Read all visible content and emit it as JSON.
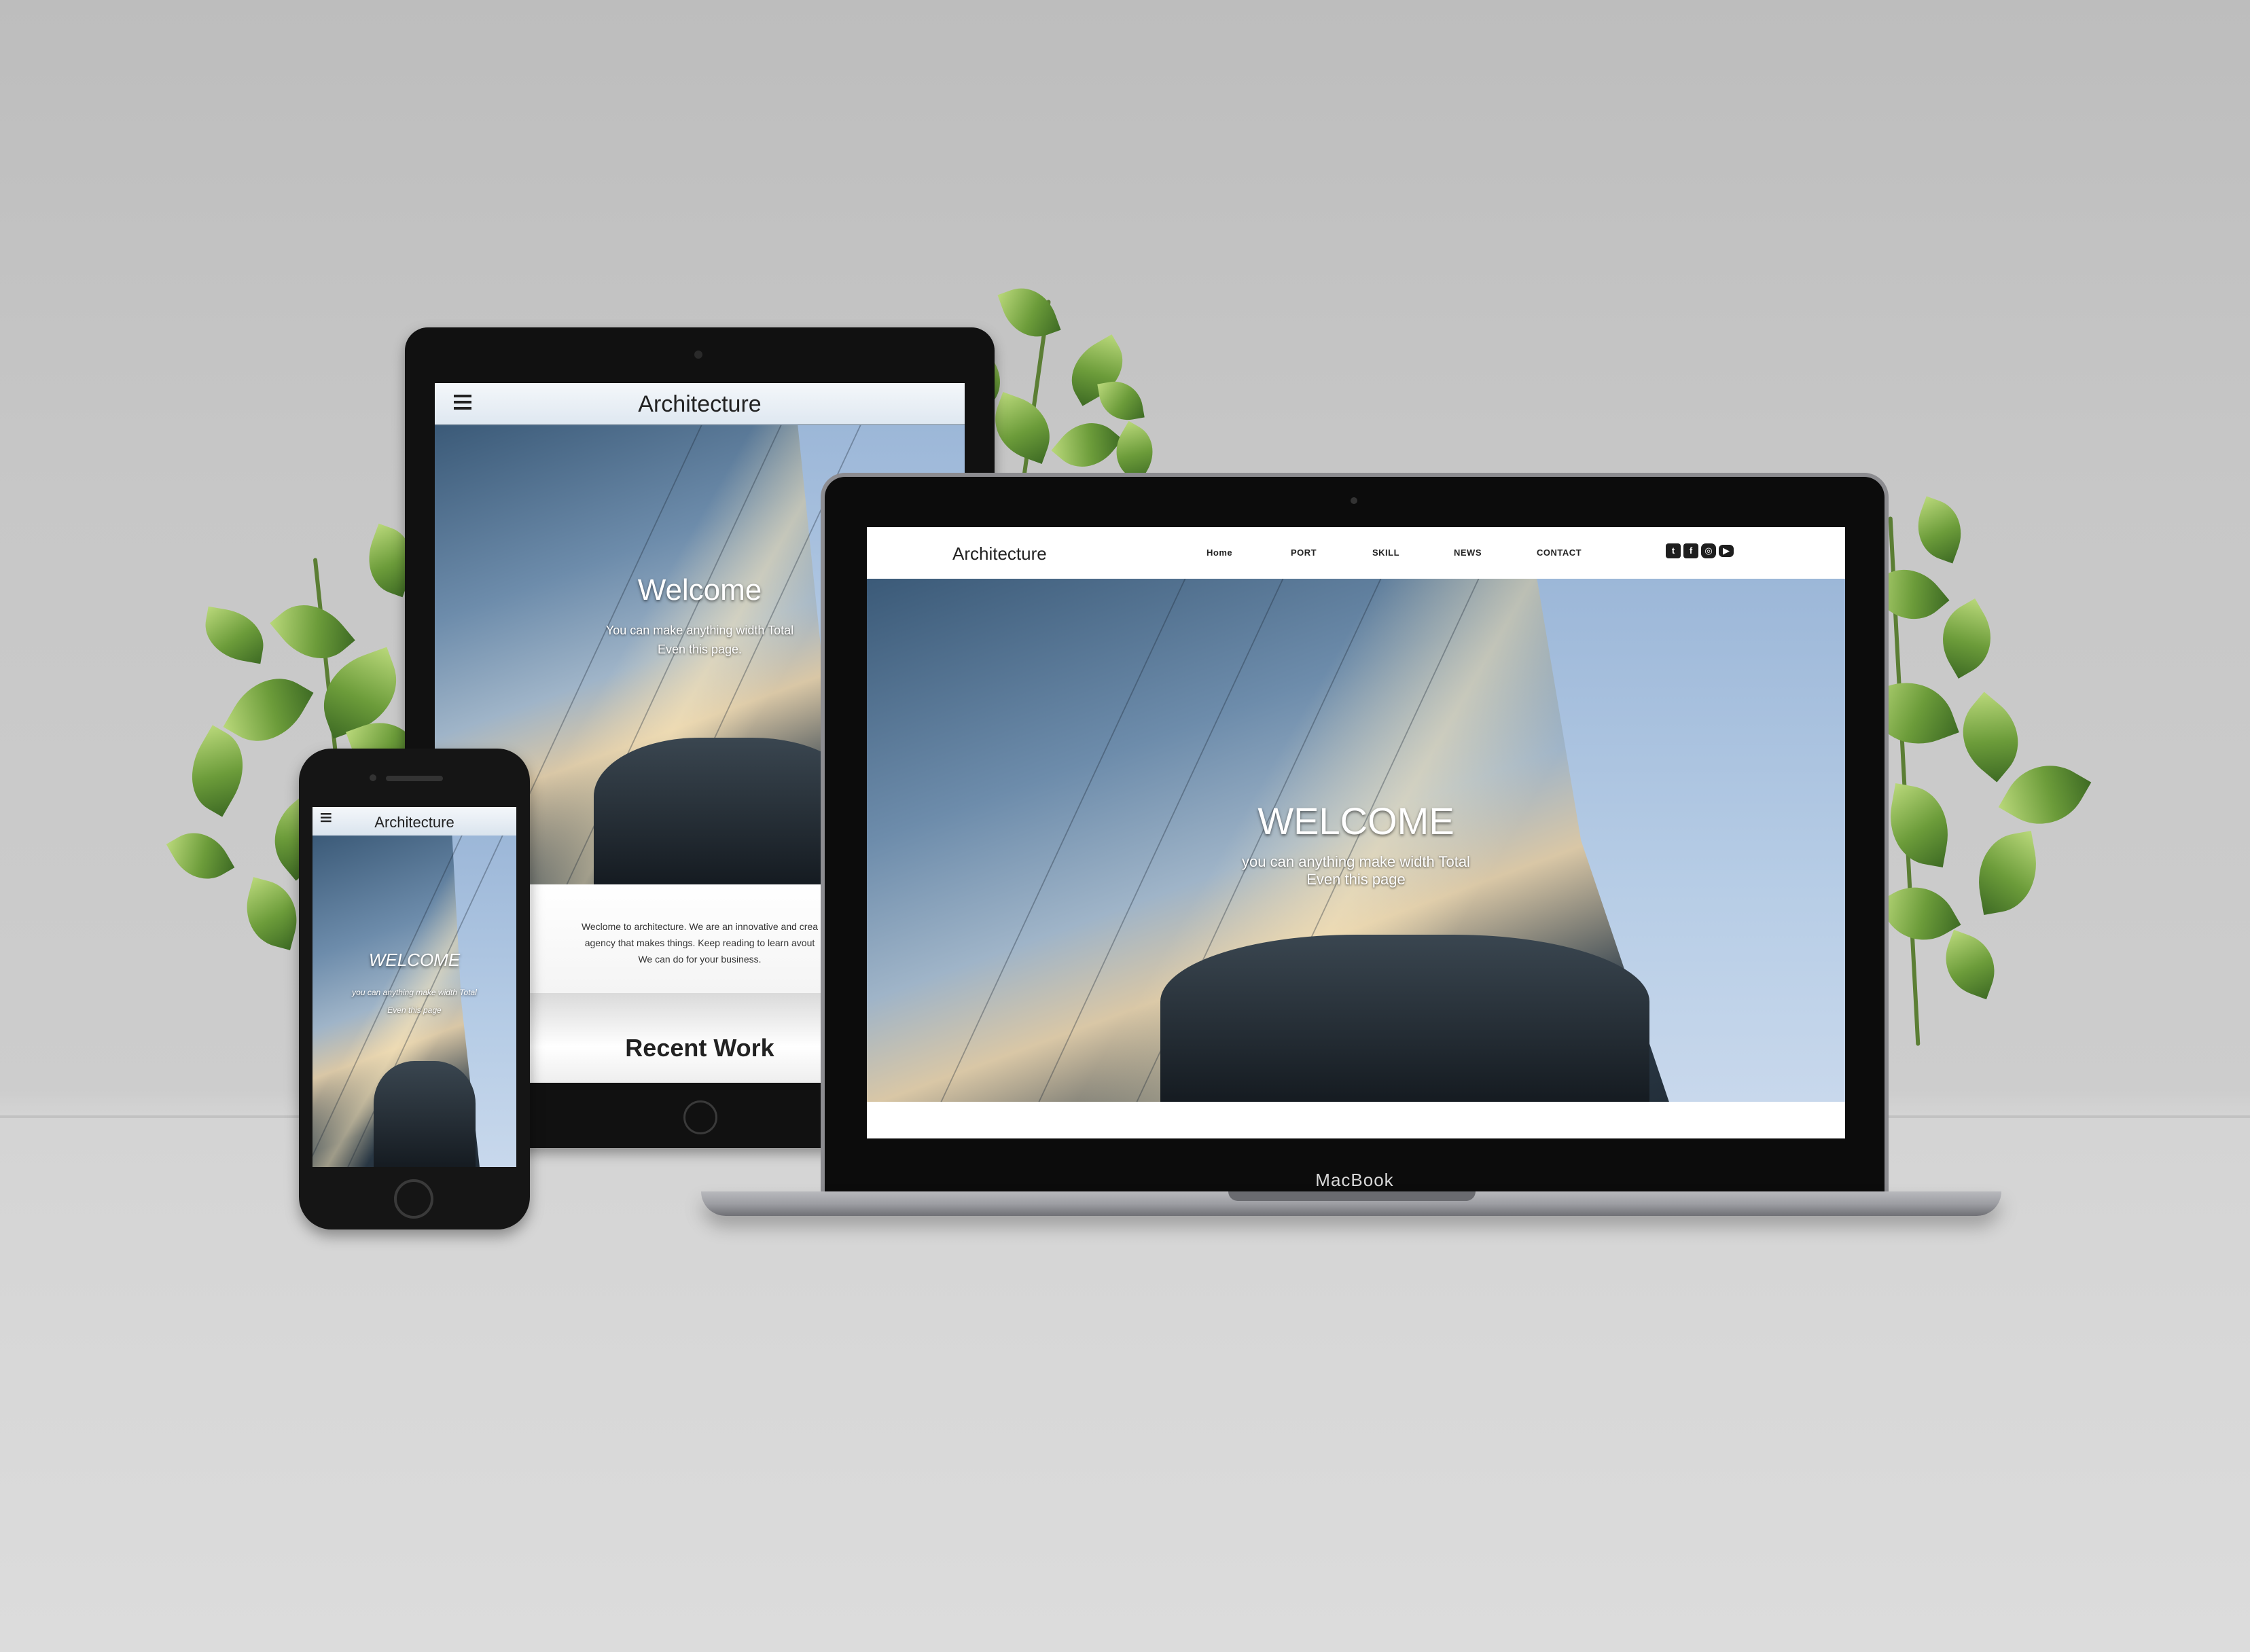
{
  "laptop": {
    "logo": "Architecture",
    "nav": [
      "Home",
      "PORT",
      "SKILL",
      "NEWS",
      "CONTACT"
    ],
    "social_icons": [
      "twitter-icon",
      "facebook-icon",
      "instagram-icon",
      "youtube-icon"
    ],
    "hero_title": "WELCOME",
    "hero_sub_1": "you can anything make width Total",
    "hero_sub_2": "Even this page",
    "brand": "MacBook"
  },
  "tablet": {
    "logo": "Architecture",
    "hero_title": "Welcome",
    "hero_sub_1": "You can make anything width Total",
    "hero_sub_2": "Even this page.",
    "intro_1": "Weclome to architecture. We are an innovative and crea",
    "intro_2": "agency that makes things. Keep reading to learn avout",
    "intro_3": "We can do for your business.",
    "section_title": "Recent Work"
  },
  "phone": {
    "logo": "Architecture",
    "hero_title": "WELCOME",
    "hero_sub_1": "you can anything make width Total",
    "hero_sub_2": "Even this page"
  },
  "colors": {
    "nav_bg": "#ffffff",
    "header_tint": "#e6eef6",
    "device_black": "#111111",
    "laptop_silver": "#9d9ea3"
  }
}
